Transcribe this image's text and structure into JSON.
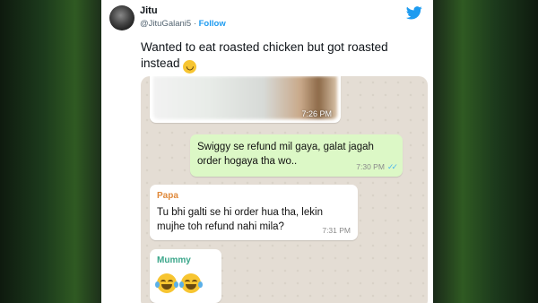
{
  "tweet": {
    "author_name": "Jitu",
    "handle": "@JituGalani5",
    "separator": "·",
    "follow_label": "Follow",
    "text": "Wanted to eat roasted chicken but got roasted instead",
    "platform_icon": "twitter-bird-icon"
  },
  "chat": {
    "image_message": {
      "time": "7:26 PM"
    },
    "messages": [
      {
        "direction": "outgoing",
        "text": "Swiggy se refund mil gaya, galat jagah order hogaya tha wo..",
        "time": "7:30 PM",
        "status": "read-double-tick"
      },
      {
        "direction": "incoming",
        "sender": "Papa",
        "sender_color": "#e0893a",
        "text": "Tu bhi galti se hi order hua tha, lekin mujhe toh refund nahi mila?",
        "time": "7:31 PM"
      },
      {
        "direction": "incoming",
        "sender": "Mummy",
        "sender_color": "#3aa68a",
        "emojis": [
          "face-with-tears-of-joy",
          "face-with-tears-of-joy"
        ]
      }
    ]
  },
  "colors": {
    "outgoing_bubble": "#dcf8c6",
    "incoming_bubble": "#ffffff",
    "chat_background": "#e4ddd4",
    "twitter_blue": "#1d9bf0"
  }
}
